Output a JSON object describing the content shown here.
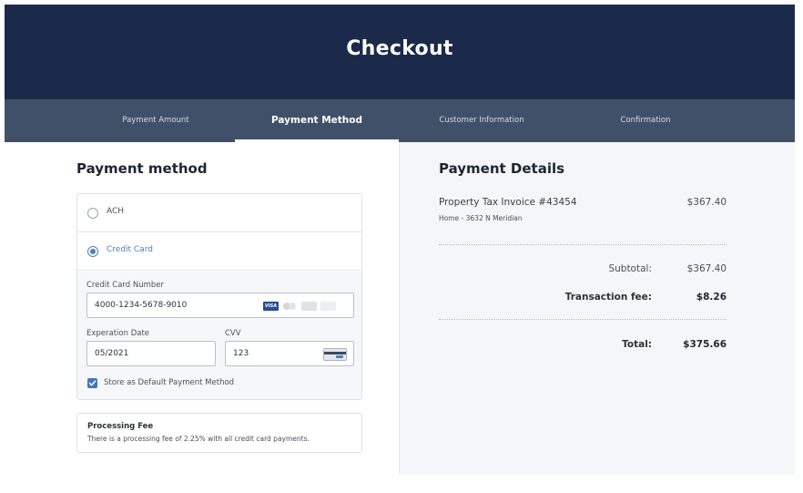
{
  "header": {
    "title": "Checkout"
  },
  "steps": [
    {
      "label": "Payment Amount"
    },
    {
      "label": "Payment Method"
    },
    {
      "label": "Customer Information"
    },
    {
      "label": "Confirmation"
    }
  ],
  "active_step": "Payment Method",
  "payment_method": {
    "title": "Payment method",
    "options": [
      {
        "label": "ACH",
        "selected": false
      },
      {
        "label": "Credit Card",
        "selected": true
      }
    ],
    "card_number": {
      "label": "Credit Card Number",
      "value": "4000-1234-5678-9010",
      "brands": [
        "visa",
        "mastercard",
        "amex",
        "discover"
      ],
      "visa_text": "VISA"
    },
    "expiration": {
      "label": "Experation Date",
      "value": "05/2021"
    },
    "cvv": {
      "label": "CVV",
      "value": "123"
    },
    "store_default": {
      "label": "Store as Default Payment Method",
      "checked": true
    }
  },
  "processing_fee": {
    "title": "Processing Fee",
    "text": "There is a processing fee of 2.25% with all credit card payments."
  },
  "payment_details": {
    "title": "Payment Details",
    "invoice_title": "Property Tax Invoice #43454",
    "invoice_sub": "Home - 3632 N Meridian",
    "invoice_amount": "$367.40",
    "subtotal_label": "Subtotal:",
    "subtotal_value": "$367.40",
    "fee_label": "Transaction fee:",
    "fee_value": "$8.26",
    "total_label": "Total:",
    "total_value": "$375.66"
  },
  "colors": {
    "header_bg": "#1b2a4a",
    "steps_bg": "#3f5068",
    "accent": "#4a7fc1"
  }
}
